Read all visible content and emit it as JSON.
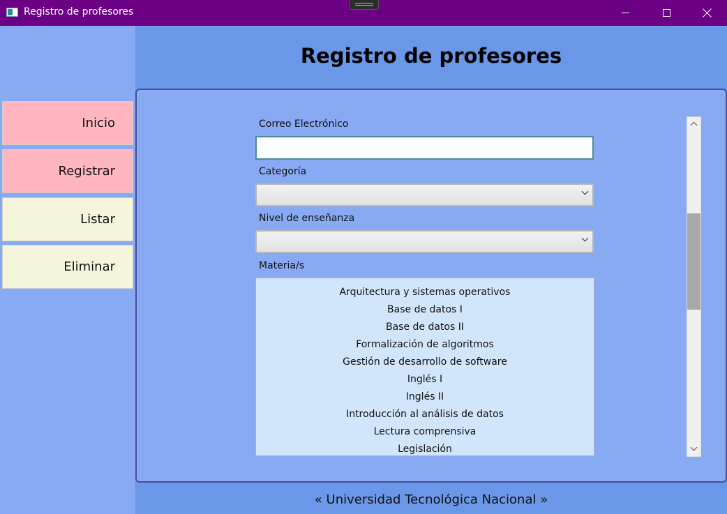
{
  "window": {
    "title": "Registro de profesores",
    "icon": "window-app-icon",
    "controls": [
      "minimize-icon",
      "maximize-icon",
      "close-icon"
    ]
  },
  "colors": {
    "titlebar": "#6b0084",
    "background": "#6b97e8",
    "sidebar": "#88aaf2",
    "nav_active": "#ffb6c1",
    "nav_inactive": "#f5f5dc",
    "list_background": "#d1e6fb",
    "panel_border": "#4a4c9c"
  },
  "sidebar": {
    "items": [
      {
        "label": "Inicio",
        "style": "pink"
      },
      {
        "label": "Registrar",
        "style": "pink"
      },
      {
        "label": "Listar",
        "style": "cream"
      },
      {
        "label": "Eliminar",
        "style": "cream"
      }
    ]
  },
  "main": {
    "heading": "Registro de profesores"
  },
  "form": {
    "email": {
      "label": "Correo Electrónico",
      "value": ""
    },
    "categoria": {
      "label": "Categoría",
      "value": ""
    },
    "nivel": {
      "label": "Nivel de enseñanza",
      "value": ""
    },
    "materias": {
      "label": "Materia/s",
      "items": [
        "Arquitectura y sistemas operativos",
        "Base de datos I",
        "Base de datos II",
        "Formalización de algoritmos",
        "Gestión de desarrollo de software",
        "Inglés I",
        "Inglés II",
        "Introducción al análisis de datos",
        "Lectura comprensiva",
        "Legislación"
      ]
    }
  },
  "footer": {
    "text": "« Universidad Tecnológica Nacional »"
  }
}
